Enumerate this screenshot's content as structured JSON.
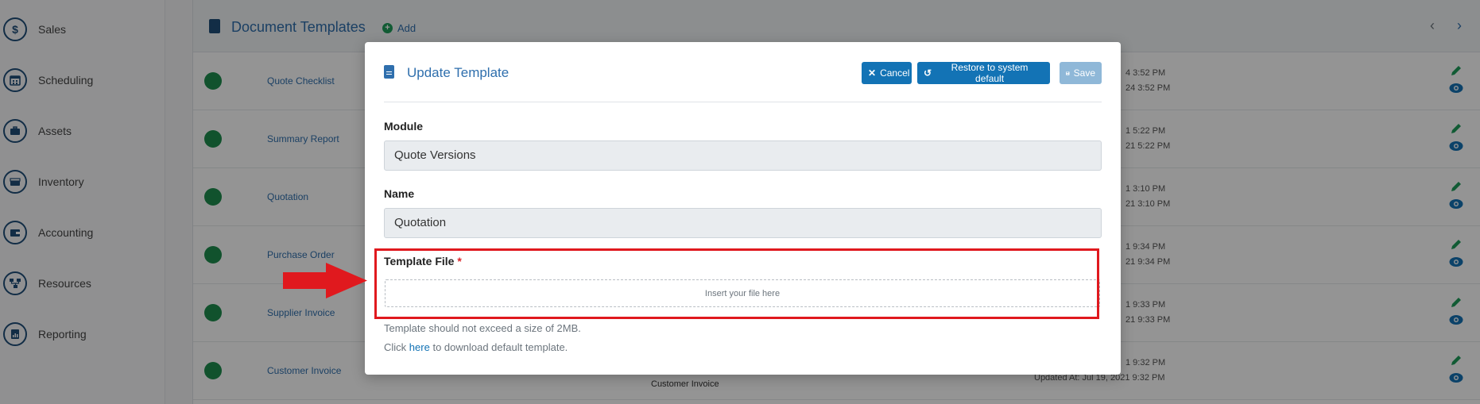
{
  "sidebar": {
    "items": [
      {
        "label": "Sales",
        "icon": "dollar-icon"
      },
      {
        "label": "Scheduling",
        "icon": "calendar-icon"
      },
      {
        "label": "Assets",
        "icon": "briefcase-icon"
      },
      {
        "label": "Inventory",
        "icon": "box-icon"
      },
      {
        "label": "Accounting",
        "icon": "wallet-icon"
      },
      {
        "label": "Resources",
        "icon": "network-icon"
      },
      {
        "label": "Reporting",
        "icon": "report-icon"
      }
    ]
  },
  "main": {
    "title": "Document Templates",
    "add_label": "Add",
    "prev_glyph": "‹",
    "next_glyph": "›",
    "rows": [
      {
        "name": "Quote Checklist",
        "created": "4 3:52 PM",
        "updated": "24 3:52 PM",
        "module": ""
      },
      {
        "name": "Summary Report",
        "created": "1 5:22 PM",
        "updated": "21 5:22 PM",
        "module": ""
      },
      {
        "name": "Quotation",
        "created": "1 3:10 PM",
        "updated": "21 3:10 PM",
        "module": ""
      },
      {
        "name": "Purchase Order",
        "created": "1 9:34 PM",
        "updated": "21 9:34 PM",
        "module": ""
      },
      {
        "name": "Supplier Invoice",
        "created": "1 9:33 PM",
        "updated": "21 9:33 PM",
        "module": ""
      },
      {
        "name": "Customer Invoice",
        "created": "1 9:32 PM",
        "updated": "Updated At: Jul 19, 2021 9:32 PM",
        "module": "Customer Invoice"
      }
    ]
  },
  "modal": {
    "title": "Update Template",
    "cancel_label": "Cancel",
    "restore_label": "Restore to system default",
    "save_label": "Save",
    "module_label": "Module",
    "module_value": "Quote Versions",
    "name_label": "Name",
    "name_value": "Quotation",
    "template_file_label": "Template File",
    "required_mark": "*",
    "dropzone_text": "Insert your file here",
    "size_hint": "Template should not exceed a size of 2MB.",
    "download_prefix": "Click",
    "download_link": "here",
    "download_suffix": "to download default template."
  },
  "colors": {
    "accent": "#1373b5",
    "title_blue": "#2f6fad",
    "status_green": "#1e8e4e",
    "highlight_red": "#e0191e"
  }
}
